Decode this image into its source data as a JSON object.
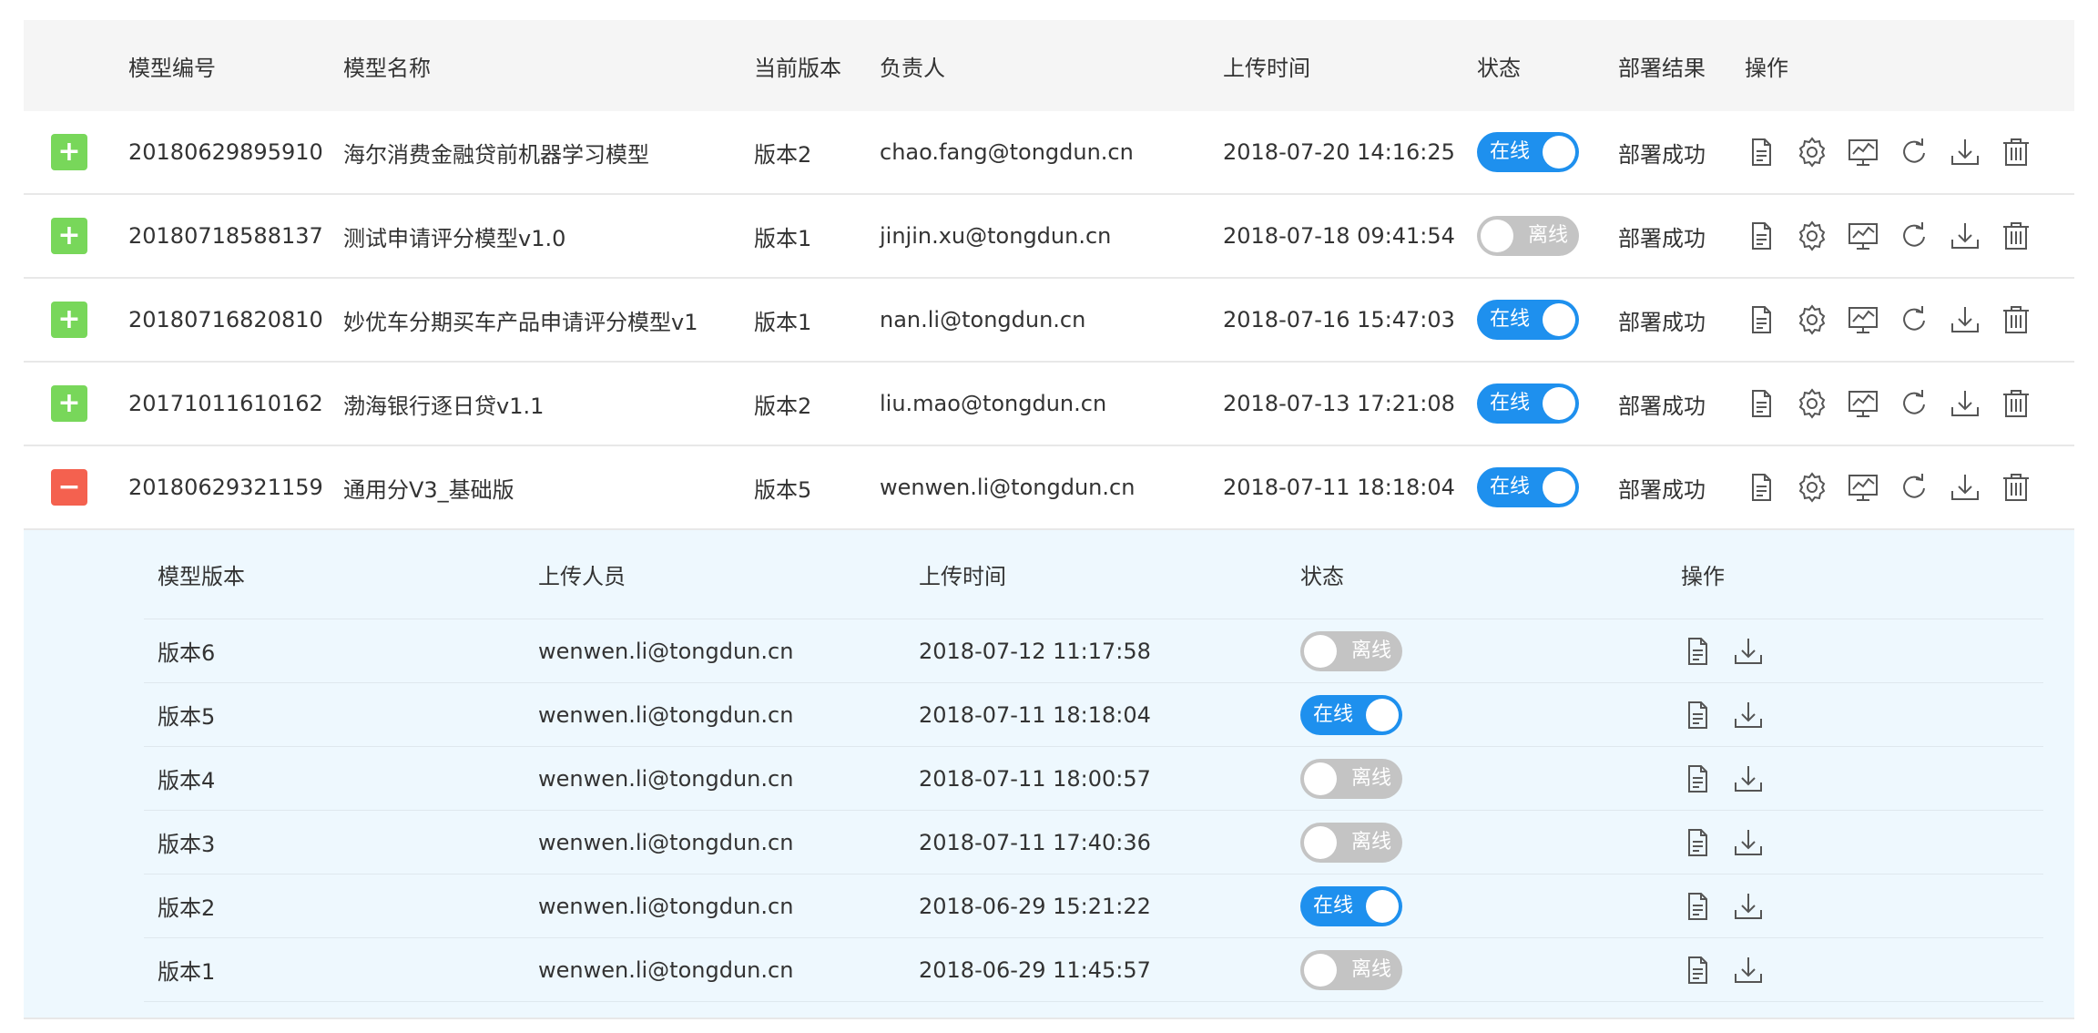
{
  "columns": {
    "id": "模型编号",
    "name": "模型名称",
    "version": "当前版本",
    "owner": "负责人",
    "upload_time": "上传时间",
    "status": "状态",
    "result": "部署结果",
    "ops": "操作"
  },
  "rows": [
    {
      "id": "20180629895910",
      "name": "海尔消费金融贷前机器学习模型",
      "version": "版本2",
      "owner": "chao.fang@tongdun.cn",
      "upload_time": "2018-07-20 14:16:25",
      "status": "在线",
      "online": true,
      "result": "部署成功",
      "expanded": false
    },
    {
      "id": "20180718588137",
      "name": "测试申请评分模型v1.0",
      "version": "版本1",
      "owner": "jinjin.xu@tongdun.cn",
      "upload_time": "2018-07-18 09:41:54",
      "status": "离线",
      "online": false,
      "result": "部署成功",
      "expanded": false
    },
    {
      "id": "20180716820810",
      "name": "妙优车分期买车产品申请评分模型v1",
      "version": "版本1",
      "owner": "nan.li@tongdun.cn",
      "upload_time": "2018-07-16 15:47:03",
      "status": "在线",
      "online": true,
      "result": "部署成功",
      "expanded": false
    },
    {
      "id": "20171011610162",
      "name": "渤海银行逐日贷v1.1",
      "version": "版本2",
      "owner": "liu.mao@tongdun.cn",
      "upload_time": "2018-07-13 17:21:08",
      "status": "在线",
      "online": true,
      "result": "部署成功",
      "expanded": false
    },
    {
      "id": "20180629321159",
      "name": "通用分V3_基础版",
      "version": "版本5",
      "owner": "wenwen.li@tongdun.cn",
      "upload_time": "2018-07-11 18:18:04",
      "status": "在线",
      "online": true,
      "result": "部署成功",
      "expanded": true
    }
  ],
  "sub_columns": {
    "version": "模型版本",
    "uploader": "上传人员",
    "upload_time": "上传时间",
    "status": "状态",
    "ops": "操作"
  },
  "sub_rows": [
    {
      "version": "版本6",
      "uploader": "wenwen.li@tongdun.cn",
      "upload_time": "2018-07-12 11:17:58",
      "status": "离线",
      "online": false
    },
    {
      "version": "版本5",
      "uploader": "wenwen.li@tongdun.cn",
      "upload_time": "2018-07-11 18:18:04",
      "status": "在线",
      "online": true
    },
    {
      "version": "版本4",
      "uploader": "wenwen.li@tongdun.cn",
      "upload_time": "2018-07-11 18:00:57",
      "status": "离线",
      "online": false
    },
    {
      "version": "版本3",
      "uploader": "wenwen.li@tongdun.cn",
      "upload_time": "2018-07-11 17:40:36",
      "status": "离线",
      "online": false
    },
    {
      "version": "版本2",
      "uploader": "wenwen.li@tongdun.cn",
      "upload_time": "2018-06-29 15:21:22",
      "status": "在线",
      "online": true
    },
    {
      "version": "版本1",
      "uploader": "wenwen.li@tongdun.cn",
      "upload_time": "2018-06-29 11:45:57",
      "status": "离线",
      "online": false
    }
  ],
  "icons": {
    "expand": "plus-icon",
    "collapse": "minus-icon",
    "row_ops": [
      "document-icon",
      "settings-icon",
      "monitor-chart-icon",
      "refresh-icon",
      "download-icon",
      "trash-icon"
    ],
    "sub_ops": [
      "document-icon",
      "download-icon"
    ]
  },
  "colors": {
    "online": "#1e90ee",
    "offline": "#c4c4c4",
    "expand": "#78d75a",
    "collapse": "#f4614f",
    "expanded_bg": "#eef8fe",
    "header_bg": "#f5f5f5"
  }
}
